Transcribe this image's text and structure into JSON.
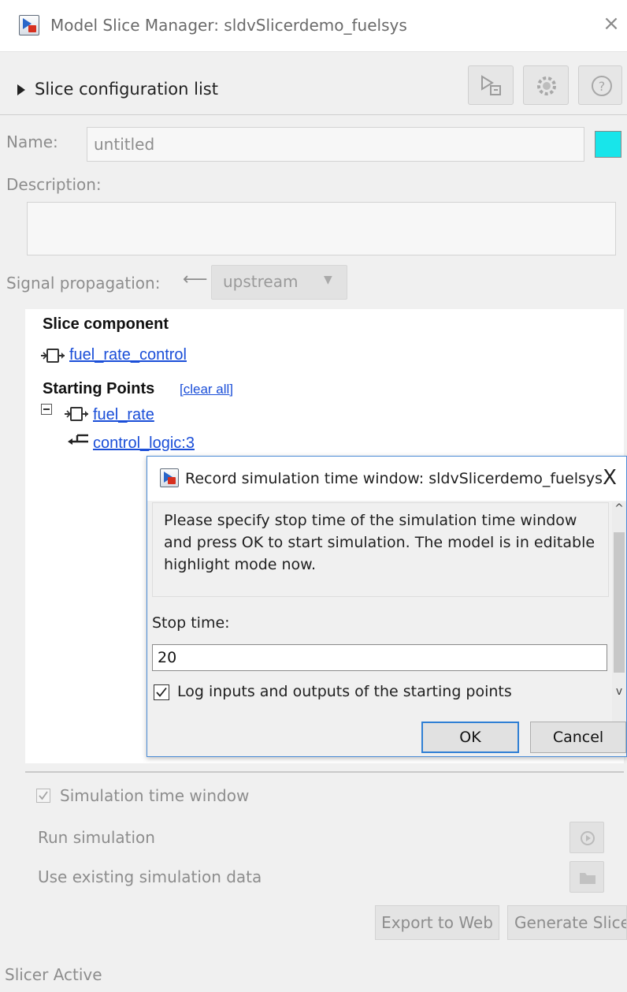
{
  "window": {
    "title": "Model Slice Manager: sldvSlicerdemo_fuelsys",
    "close_glyph": "×",
    "icon": "simulink-app-icon"
  },
  "toolbar": {
    "icons": [
      "model-slicer-icon",
      "gear-icon",
      "help-icon"
    ]
  },
  "slice_config": {
    "label": "Slice configuration list"
  },
  "form": {
    "name_label": "Name:",
    "name_value": "untitled",
    "highlight_color": "#18e5ea",
    "description_label": "Description:",
    "description_value": "",
    "signal_propagation_label": "Signal propagation:",
    "signal_propagation_value": "upstream"
  },
  "tree": {
    "slice_component_heading": "Slice component",
    "slice_component": "fuel_rate_control",
    "starting_points_heading": "Starting Points",
    "clear_all": "[clear all]",
    "starting_points": [
      "fuel_rate",
      "control_logic:3"
    ]
  },
  "bottom": {
    "sim_window_label": "Simulation time window",
    "sim_window_checked": true,
    "run_simulation_label": "Run simulation",
    "use_existing_label": "Use existing simulation data",
    "export_label": "Export to Web",
    "generate_label": "Generate Slice",
    "status": "Slicer Active"
  },
  "dialog": {
    "title": "Record simulation time window: sldvSlicerdemo_fuelsys",
    "close_glyph": "X",
    "message": "Please specify stop time of the simulation time window and press OK to start simulation. The model is in editable highlight mode now.",
    "stop_time_label": "Stop time:",
    "stop_time_value": "20",
    "log_label": "Log inputs and outputs of the starting points",
    "log_checked": true,
    "ok_label": "OK",
    "cancel_label": "Cancel"
  },
  "colors": {
    "link": "#1a4ed8",
    "dialog_border": "#4a8bd6",
    "ok_focus": "#2f7fd4"
  }
}
